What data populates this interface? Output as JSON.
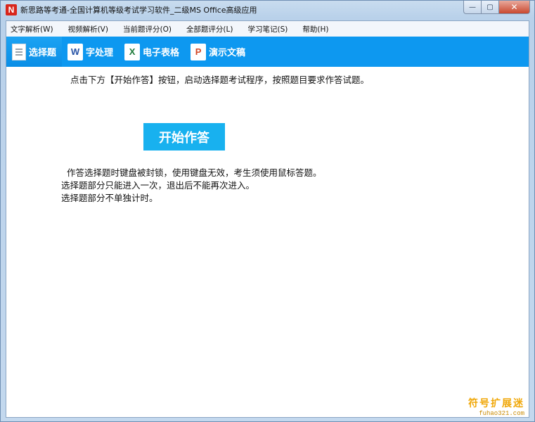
{
  "window": {
    "title": "新思路等考通-全国计算机等级考试学习软件_二级MS Office高级应用",
    "icon_letter": "N",
    "controls": {
      "minimize": "—",
      "maximize": "▢",
      "close": "✕"
    }
  },
  "menubar": {
    "items": [
      "文字解析(W)",
      "视频解析(V)",
      "当前题评分(O)",
      "全部题评分(L)",
      "学习笔记(S)",
      "帮助(H)"
    ]
  },
  "toolbar": {
    "items": [
      {
        "label": "选择题",
        "icon": "document-icon",
        "glyph": ""
      },
      {
        "label": "字处理",
        "icon": "word-icon",
        "glyph": "W"
      },
      {
        "label": "电子表格",
        "icon": "excel-icon",
        "glyph": "X"
      },
      {
        "label": "演示文稿",
        "icon": "powerpoint-icon",
        "glyph": "P"
      }
    ],
    "active_index": 0
  },
  "content": {
    "instruction": "点击下方【开始作答】按钮，启动选择题考试程序，按照题目要求作答试题。",
    "start_button": "开始作答",
    "notes": [
      "作答选择题时键盘被封锁，使用键盘无效，考生须使用鼠标答题。",
      "选择题部分只能进入一次，退出后不能再次进入。",
      "选择题部分不单独计时。"
    ]
  },
  "watermark": {
    "text": "符号扩展迷",
    "url": "fuhao321.com"
  },
  "colors": {
    "toolbar_bg": "#0d98f0",
    "start_button_bg": "#18b1ef",
    "watermark": "#f0a80a"
  }
}
